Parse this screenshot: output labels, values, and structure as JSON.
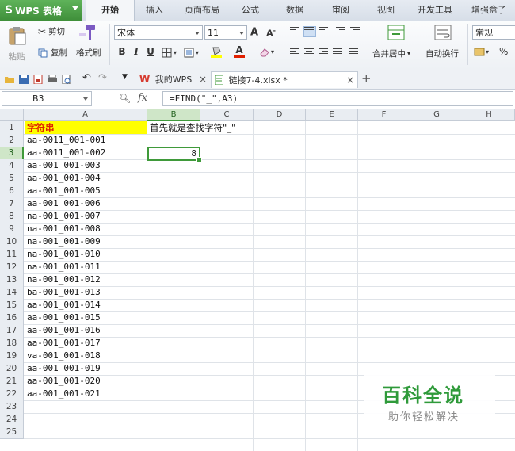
{
  "app": {
    "logo": "S",
    "name": "WPS 表格"
  },
  "menu_tabs": [
    "开始",
    "插入",
    "页面布局",
    "公式",
    "数据",
    "审阅",
    "视图",
    "开发工具",
    "增强盒子"
  ],
  "ribbon": {
    "paste": "粘贴",
    "cut": "剪切",
    "copy": "复制",
    "format_painter": "格式刷",
    "font_name": "宋体",
    "font_size": "11",
    "bold": "B",
    "italic": "I",
    "underline": "U",
    "grow_font": "A",
    "shrink_font": "A",
    "merge_center": "合并居中",
    "wrap_text": "自动换行",
    "number_format": "常规",
    "percent": "%"
  },
  "doc_tabs": {
    "home_tab": "我的WPS",
    "file_tab": "链接7-4.xlsx *",
    "new_tab": "+"
  },
  "formula_bar": {
    "name_box": "B3",
    "fx": "fx",
    "formula": "=FIND(\"_\",A3)"
  },
  "grid": {
    "columns": [
      "A",
      "B",
      "C",
      "D",
      "E",
      "F",
      "G",
      "H"
    ],
    "rows": [
      "1",
      "2",
      "3",
      "4",
      "5",
      "6",
      "7",
      "8",
      "9",
      "10",
      "11",
      "12",
      "13",
      "14",
      "15",
      "16",
      "17",
      "18",
      "19",
      "20",
      "21",
      "22",
      "23",
      "24",
      "25"
    ],
    "a1": "字符串",
    "b1": "首先就是查找字符\"_\"",
    "b3": "8",
    "column_a": [
      "aa-0011_001-001",
      "aa-0011_001-002",
      "aa-001_001-003",
      "aa-001_001-004",
      "aa-001_001-005",
      "aa-001_001-006",
      "na-001_001-007",
      "na-001_001-008",
      "na-001_001-009",
      "na-001_001-010",
      "na-001_001-011",
      "na-001_001-012",
      "ba-001_001-013",
      "aa-001_001-014",
      "aa-001_001-015",
      "aa-001_001-016",
      "aa-001_001-017",
      "va-001_001-018",
      "aa-001_001-019",
      "aa-001_001-020",
      "aa-001_001-021"
    ]
  },
  "watermark": {
    "title": "百科全说",
    "subtitle": "助你轻松解决"
  },
  "colors": {
    "accent_green": "#3f9a3a",
    "header_yellow": "#ffff00",
    "header_text_red": "#e02000"
  }
}
